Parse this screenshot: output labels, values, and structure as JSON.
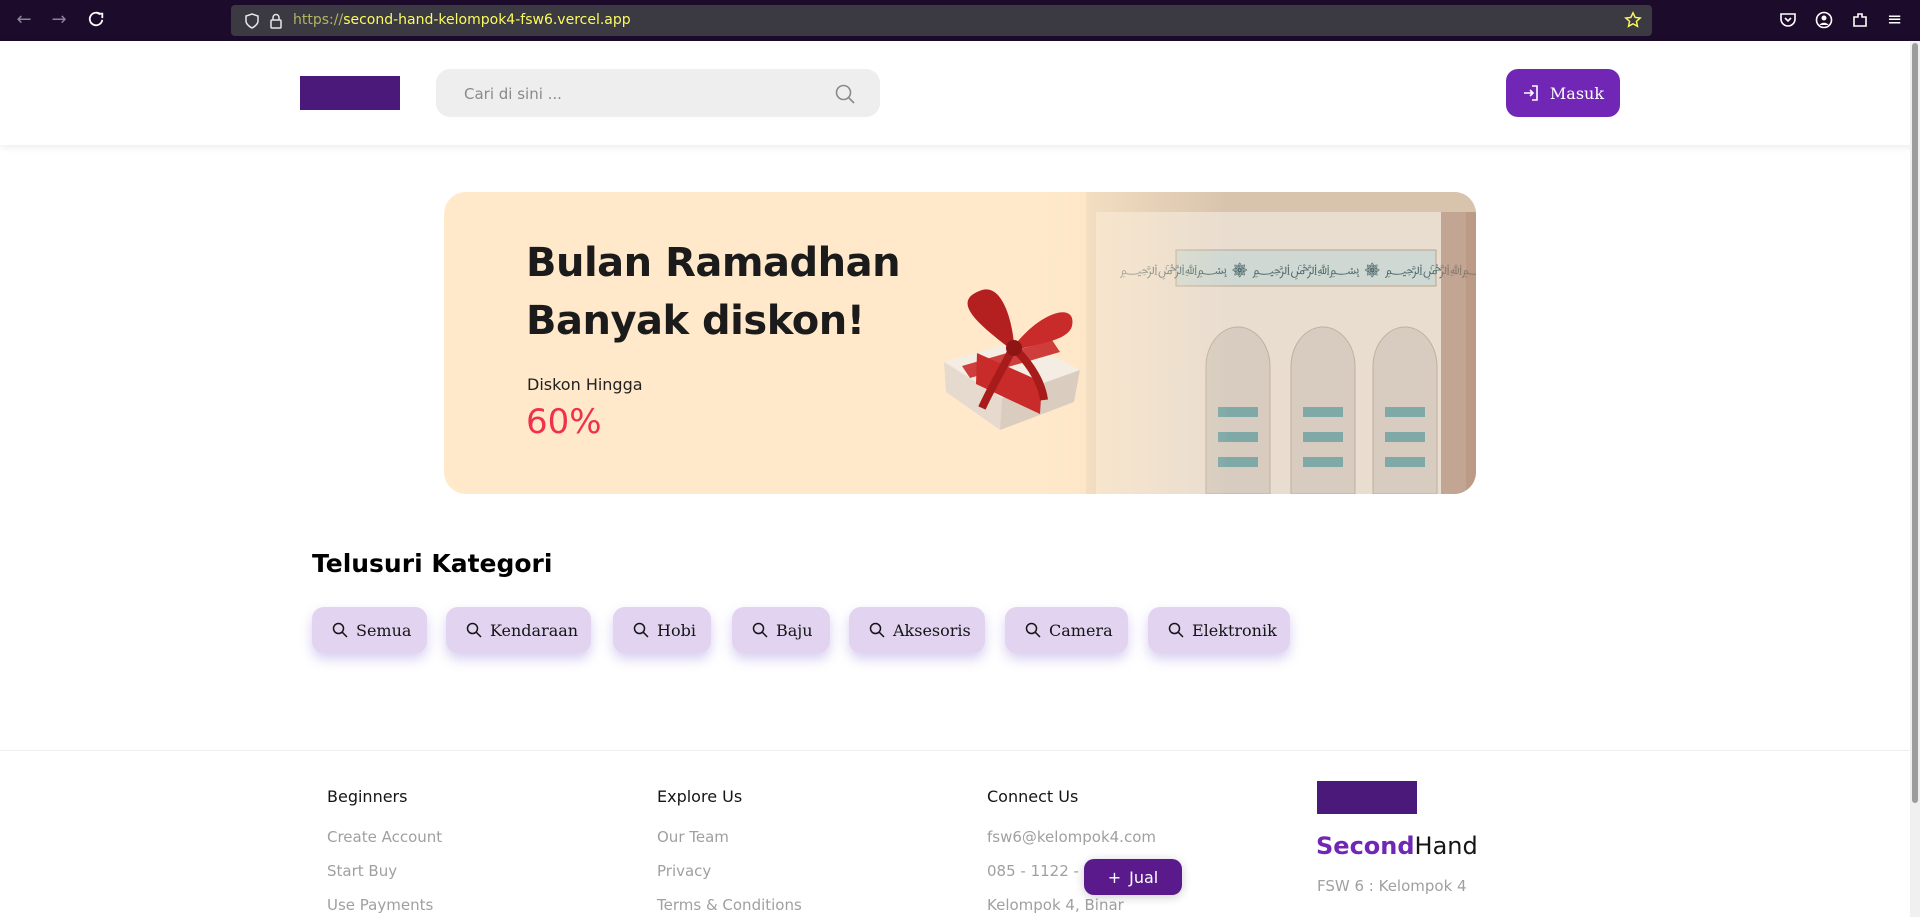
{
  "browser": {
    "url_protocol": "https://",
    "url_host": "second-hand-kelompok4-fsw6.vercel.app",
    "icons": [
      "back-icon",
      "forward-icon",
      "reload-icon",
      "shield-icon",
      "lock-icon",
      "star-icon",
      "pocket-icon",
      "account-icon",
      "extensions-icon",
      "menu-icon"
    ]
  },
  "header": {
    "search_placeholder": "Cari di sini ...",
    "login_label": "Masuk"
  },
  "banner": {
    "title_line1": "Bulan Ramadhan",
    "title_line2": "Banyak diskon!",
    "discount_label": "Diskon Hingga",
    "discount_value": "60%"
  },
  "categories": {
    "title": "Telusuri Kategori",
    "items": [
      {
        "label": "Semua"
      },
      {
        "label": "Kendaraan"
      },
      {
        "label": "Hobi"
      },
      {
        "label": "Baju"
      },
      {
        "label": "Aksesoris"
      },
      {
        "label": "Camera"
      },
      {
        "label": "Elektronik"
      }
    ]
  },
  "footer": {
    "beginners": {
      "title": "Beginners",
      "links": [
        "Create Account",
        "Start Buy",
        "Use Payments"
      ]
    },
    "explore": {
      "title": "Explore Us",
      "links": [
        "Our Team",
        "Privacy",
        "Terms & Conditions"
      ]
    },
    "connect": {
      "title": "Connect Us",
      "links": [
        "fsw6@kelompok4.com",
        "085 - 1122 - 3",
        "Kelompok 4, Binar"
      ]
    },
    "brand_a": "Second",
    "brand_b": "Hand",
    "brand_sub": "FSW 6 : Kelompok 4",
    "sell_label": "Jual"
  },
  "colors": {
    "primary": "#7126b5",
    "dark_primary": "#4b1979",
    "chip_bg": "#e2d4f0",
    "accent_red": "#f0314e",
    "banner_bg": "#ffe9ca"
  }
}
